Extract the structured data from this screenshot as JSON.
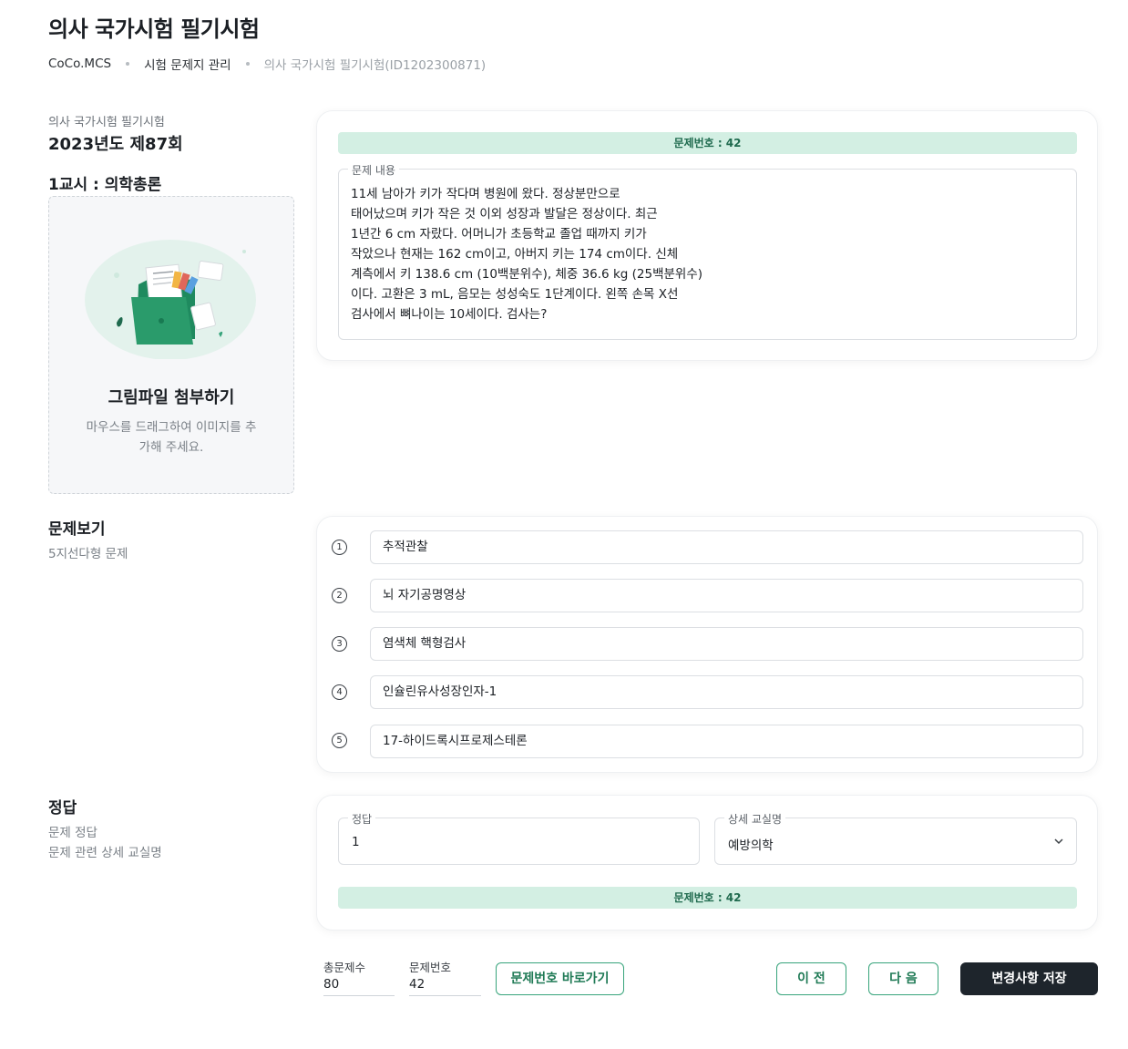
{
  "page_title": "의사 국가시험 필기시험",
  "breadcrumb": [
    "CoCo.MCS",
    "시험 문제지 관리",
    "의사 국가시험 필기시험(ID1202300871)"
  ],
  "exam": {
    "name": "의사 국가시험 필기시험",
    "year_round": "2023년도 제87회",
    "period": "1교시 : 의학총론"
  },
  "upload": {
    "title": "그림파일 첨부하기",
    "description": "마우스를 드래그하여 이미지를 추가해 주세요."
  },
  "question": {
    "number_label": "문제번호 : 42",
    "content_label": "문제 내용",
    "content": "11세 남아가 키가 작다며 병원에 왔다. 정상분만으로\n태어났으며 키가 작은 것 이외 성장과 발달은 정상이다. 최근\n1년간 6 cm 자랐다. 어머니가 초등학교 졸업 때까지 키가\n작았으나 현재는 162 cm이고, 아버지 키는 174 cm이다. 신체\n계측에서 키 138.6 cm (10백분위수), 체중 36.6 kg (25백분위수)\n이다. 고환은 3 mL, 음모는 성성숙도 1단계이다. 왼쪽 손목 X선\n검사에서 뼈나이는 10세이다. 검사는?"
  },
  "choices_section": {
    "title": "문제보기",
    "description": "5지선다형 문제",
    "choices": [
      {
        "number": "1",
        "text": "추적관찰"
      },
      {
        "number": "2",
        "text": "뇌 자기공명영상"
      },
      {
        "number": "3",
        "text": "염색체 핵형검사"
      },
      {
        "number": "4",
        "text": "인슐린유사성장인자-1"
      },
      {
        "number": "5",
        "text": "17-하이드록시프로제스테론"
      }
    ]
  },
  "answer_section": {
    "title": "정답",
    "description_1": "문제 정답",
    "description_2": "문제 관련 상세 교실명",
    "answer_label": "정답",
    "answer_value": "1",
    "department_label": "상세 교실명",
    "department_value": "예방의학",
    "number_label": "문제번호 : 42"
  },
  "footer": {
    "total_label": "총문제수",
    "total_value": "80",
    "qno_label": "문제번호",
    "qno_value": "42",
    "goto_button": "문제번호 바로가기",
    "prev_button": "이 전",
    "next_button": "다 음",
    "save_button": "변경사항 저장"
  },
  "colors": {
    "accent": "#37a47b",
    "accent_light": "#d3efe3",
    "dark_button": "#1e252c"
  }
}
